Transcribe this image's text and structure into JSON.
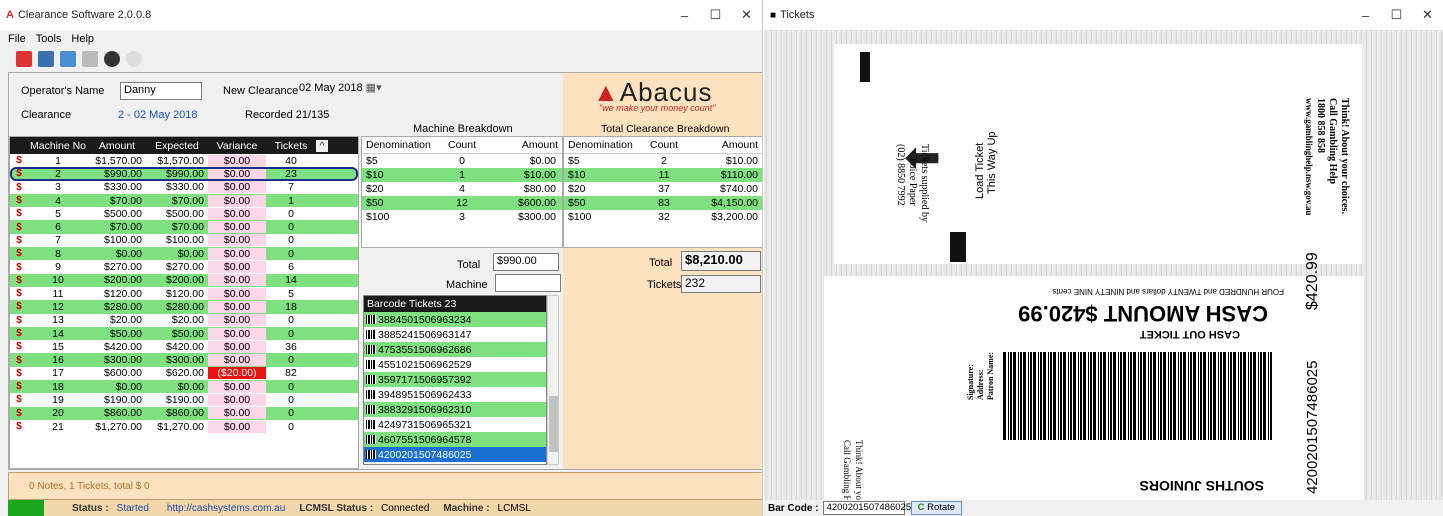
{
  "app": {
    "title": "Clearance Software 2.0.0.8",
    "menu": [
      "File",
      "Tools",
      "Help"
    ]
  },
  "form": {
    "operator_label": "Operator's Name",
    "operator_value": "Danny",
    "new_clearance_label": "New Clearance",
    "new_clearance_value": "02 May 2018",
    "clearance_label": "Clearance",
    "clearance_value": "2 - 02 May 2018",
    "recorded": "Recorded 21/135"
  },
  "logo": {
    "name": "Abacus",
    "tagline": "\"we make your money count\""
  },
  "machines": {
    "headers": [
      "Machine No",
      "Amount",
      "Expected",
      "Variance",
      "Tickets"
    ],
    "rows": [
      [
        "1",
        "$1,570.00",
        "$1,570.00",
        "$0.00",
        "40"
      ],
      [
        "2",
        "$990.00",
        "$990.00",
        "$0.00",
        "23"
      ],
      [
        "3",
        "$330.00",
        "$330.00",
        "$0.00",
        "7"
      ],
      [
        "4",
        "$70.00",
        "$70.00",
        "$0.00",
        "1"
      ],
      [
        "5",
        "$500.00",
        "$500.00",
        "$0.00",
        "0"
      ],
      [
        "6",
        "$70.00",
        "$70.00",
        "$0.00",
        "0"
      ],
      [
        "7",
        "$100.00",
        "$100.00",
        "$0.00",
        "0"
      ],
      [
        "8",
        "$0.00",
        "$0.00",
        "$0.00",
        "0"
      ],
      [
        "9",
        "$270.00",
        "$270.00",
        "$0.00",
        "6"
      ],
      [
        "10",
        "$200.00",
        "$200.00",
        "$0.00",
        "14"
      ],
      [
        "11",
        "$120.00",
        "$120.00",
        "$0.00",
        "5"
      ],
      [
        "12",
        "$280.00",
        "$280.00",
        "$0.00",
        "18"
      ],
      [
        "13",
        "$20.00",
        "$20.00",
        "$0.00",
        "0"
      ],
      [
        "14",
        "$50.00",
        "$50.00",
        "$0.00",
        "0"
      ],
      [
        "15",
        "$420.00",
        "$420.00",
        "$0.00",
        "36"
      ],
      [
        "16",
        "$300.00",
        "$300.00",
        "$0.00",
        "0"
      ],
      [
        "17",
        "$600.00",
        "$620.00",
        "($20.00)",
        "82"
      ],
      [
        "18",
        "$0.00",
        "$0.00",
        "$0.00",
        "0"
      ],
      [
        "19",
        "$190.00",
        "$190.00",
        "$0.00",
        "0"
      ],
      [
        "20",
        "$860.00",
        "$860.00",
        "$0.00",
        "0"
      ],
      [
        "21",
        "$1,270.00",
        "$1,270.00",
        "$0.00",
        "0"
      ]
    ]
  },
  "machine_breakdown": {
    "title": "Machine Breakdown",
    "headers": [
      "Denomination",
      "Count",
      "Amount"
    ],
    "rows": [
      [
        "$5",
        "0",
        "$0.00"
      ],
      [
        "$10",
        "1",
        "$10.00"
      ],
      [
        "$20",
        "4",
        "$80.00"
      ],
      [
        "$50",
        "12",
        "$600.00"
      ],
      [
        "$100",
        "3",
        "$300.00"
      ]
    ],
    "total_label": "Total",
    "total_value": "$990.00",
    "machine_label": "Machine",
    "machine_value": ""
  },
  "total_breakdown": {
    "title": "Total Clearance Breakdown",
    "headers": [
      "Denomination",
      "Count",
      "Amount"
    ],
    "rows": [
      [
        "$5",
        "2",
        "$10.00"
      ],
      [
        "$10",
        "11",
        "$110.00"
      ],
      [
        "$20",
        "37",
        "$740.00"
      ],
      [
        "$50",
        "83",
        "$4,150.00"
      ],
      [
        "$100",
        "32",
        "$3,200.00"
      ]
    ],
    "total_label": "Total",
    "total_value": "$8,210.00",
    "tickets_label": "Tickets",
    "tickets_value": "232"
  },
  "barcodes": {
    "title": "Barcode Tickets 23",
    "items": [
      "3884501506963234",
      "3885241506963147",
      "4753551506962686",
      "4551021506962529",
      "3597171506957392",
      "3948951506962433",
      "3883291506962310",
      "4249731506965321",
      "4607551506964578",
      "4200201507486025"
    ]
  },
  "notes": "0 Notes, 1 Tickets, total $ 0",
  "status": {
    "status_label": "Status :",
    "status_value": "Started",
    "url": "http://cashsystems.com.au",
    "lcmsl_label": "LCMSL Status :",
    "lcmsl_value": "Connected",
    "machine_label": "Machine :",
    "machine_value": "LCMSL"
  },
  "tickets_win": {
    "title": "Tickets",
    "barcode_label": "Bar Code :",
    "barcode_value": "4200201507486025",
    "rotate_label": "Rotate"
  },
  "ticket_img": {
    "load_text": "Load Ticket",
    "way_up": "This Way Up",
    "supplied": "Tickets supplied by",
    "choice": "Choice Paper",
    "phone": "(02) 8850 7992",
    "think": "Think! About your choices.",
    "call": "Call Gambling Help",
    "help_num": "1800 858 858",
    "help_url": "www.gamblinghelp.nsw.gov.au",
    "cash_amount": "CASH AMOUNT $420.99",
    "cashout": "CASH OUT TICKET",
    "words": "FOUR HUNDRED and TWENTY dollars and NINETY NINE cents",
    "num_big": "4200201507486025",
    "amt_side": "$420.99",
    "club": "SOUTHS JUNIORS",
    "signature": "Signature:",
    "address": "Address:",
    "patron": "Patron Name:"
  }
}
